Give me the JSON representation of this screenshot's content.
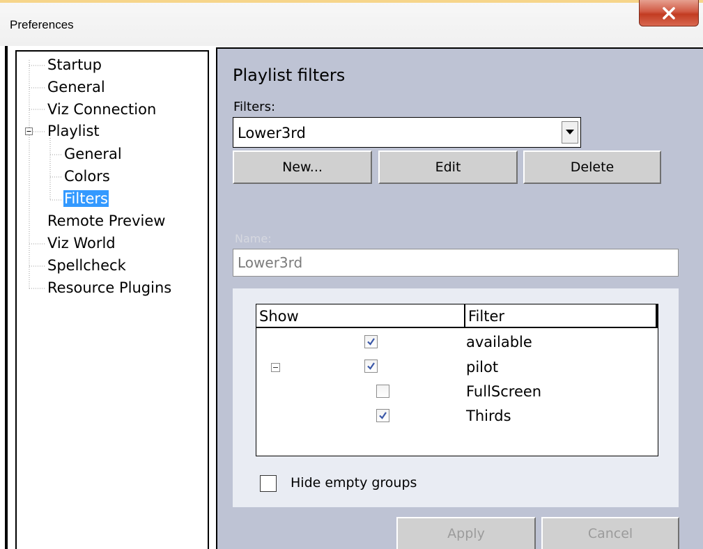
{
  "window": {
    "title": "Preferences"
  },
  "tree": {
    "items": [
      {
        "label": "Startup"
      },
      {
        "label": "General"
      },
      {
        "label": "Viz Connection"
      },
      {
        "label": "Playlist"
      },
      {
        "label": "General"
      },
      {
        "label": "Colors"
      },
      {
        "label": "Filters"
      },
      {
        "label": "Remote Preview"
      },
      {
        "label": "Viz World"
      },
      {
        "label": "Spellcheck"
      },
      {
        "label": "Resource Plugins"
      }
    ],
    "selected": "Filters"
  },
  "panel": {
    "heading": "Playlist filters",
    "filters_label": "Filters:",
    "filters_value": "Lower3rd",
    "buttons": {
      "new": "New...",
      "edit": "Edit",
      "delete": "Delete"
    },
    "name_label": "Name:",
    "name_value": "Lower3rd"
  },
  "filter_table": {
    "columns": [
      "Show",
      "Filter"
    ],
    "rows": [
      {
        "filter": "available",
        "checked": true
      },
      {
        "filter": "pilot",
        "checked": true,
        "expanded": true
      },
      {
        "filter": "FullScreen",
        "checked": false
      },
      {
        "filter": "Thirds",
        "checked": true
      }
    ]
  },
  "hide_empty_groups": {
    "label": "Hide empty groups",
    "checked": false
  },
  "footer": {
    "apply": "Apply",
    "cancel": "Cancel"
  }
}
